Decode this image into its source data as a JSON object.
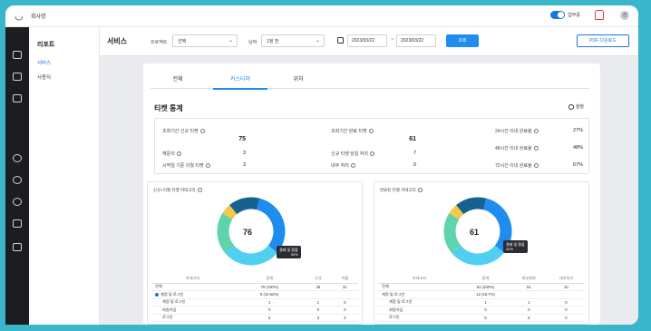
{
  "topbar": {
    "company": "회사명",
    "toggle_label": "업무중",
    "avatar": "관"
  },
  "sidemenu": {
    "heading": "리포트",
    "items": [
      {
        "label": "서비스",
        "active": true
      },
      {
        "label": "사용자",
        "active": false
      }
    ]
  },
  "toolbar": {
    "title": "서비스",
    "project_label": "프로젝트",
    "project_value": "선택",
    "period_label": "날짜",
    "period_value": "1월 전",
    "date_from": "2023/03/22",
    "date_to": "2023/03/22",
    "query_button": "조회",
    "pdf_button": "PDF 다운로드"
  },
  "tabs": [
    {
      "label": "전체"
    },
    {
      "label": "커스터머"
    },
    {
      "label": "위처"
    }
  ],
  "section": {
    "title": "티켓 통계",
    "settings_label": "설정"
  },
  "stats": {
    "col1": [
      {
        "label": "조회기간 신규 티켓",
        "value": "75"
      },
      {
        "label": "재문의",
        "value": "3"
      },
      {
        "label": "시작일 기준 이월 티켓",
        "value": "3"
      }
    ],
    "col2": [
      {
        "label": "조회기간 완료 티켓",
        "value": "61"
      },
      {
        "label": "신규 티켓 당일 처리",
        "value": "7"
      },
      {
        "label": "내부 처리",
        "value": "0"
      }
    ],
    "col3": [
      {
        "label": "24시간 이내 완료율",
        "value": "27%"
      },
      {
        "label": "48시간 이내 완료율",
        "value": "48%"
      },
      {
        "label": "72시간 이내 완료율",
        "value": "67%"
      }
    ]
  },
  "panel_left": {
    "title": "신규+이월 티켓 카테고리",
    "center_value": "76",
    "tooltip_title": "결제 및 환불",
    "tooltip_value": "32%",
    "segments": [
      {
        "color": "#1f8cf0",
        "share": 0.32
      },
      {
        "color": "#4fd0f0",
        "share": 0.28
      },
      {
        "color": "#5fd3a9",
        "share": 0.2
      },
      {
        "color": "#f2c94c",
        "share": 0.05
      },
      {
        "color": "#15628f",
        "share": 0.15
      }
    ],
    "headers": [
      "카테고리",
      "합계",
      "신규",
      "이월"
    ],
    "rows": [
      {
        "c": [
          "전체",
          "76 (100%)",
          "45",
          "31"
        ],
        "sub": false,
        "dot": false
      },
      {
        "c": [
          "계정 및 로그인",
          "8 (10.52%)",
          "",
          ""
        ],
        "sub": false,
        "dot": true
      },
      {
        "c": [
          "계정 및 로그인",
          "1",
          "1",
          "0"
        ],
        "sub": true,
        "dot": false
      },
      {
        "c": [
          "회원가입",
          "0",
          "0",
          "0"
        ],
        "sub": true,
        "dot": false
      },
      {
        "c": [
          "로그인",
          "5",
          "3",
          "3"
        ],
        "sub": true,
        "dot": false
      }
    ]
  },
  "panel_right": {
    "title": "완료된 티켓 카테고리",
    "center_value": "61",
    "tooltip_title": "결제 및 환불",
    "tooltip_value": "32%",
    "segments": [
      {
        "color": "#1f8cf0",
        "share": 0.32
      },
      {
        "color": "#4fd0f0",
        "share": 0.28
      },
      {
        "color": "#5fd3a9",
        "share": 0.2
      },
      {
        "color": "#f2c94c",
        "share": 0.05
      },
      {
        "color": "#15628f",
        "share": 0.15
      }
    ],
    "headers": [
      "카테고리",
      "합계",
      "외부완료",
      "내부처리"
    ],
    "rows": [
      {
        "c": [
          "전체",
          "61 (100%)",
          "51",
          "10"
        ],
        "sub": false,
        "dot": false
      },
      {
        "c": [
          "계정 및 로그인",
          "12 (19.7%)",
          "",
          ""
        ],
        "sub": false,
        "dot": false
      },
      {
        "c": [
          "계정 및 로그인",
          "1",
          "1",
          "0"
        ],
        "sub": true,
        "dot": false
      },
      {
        "c": [
          "회원가입",
          "0",
          "0",
          "0"
        ],
        "sub": true,
        "dot": false
      },
      {
        "c": [
          "로그인",
          "5",
          "5",
          "0"
        ],
        "sub": true,
        "dot": false
      }
    ]
  }
}
